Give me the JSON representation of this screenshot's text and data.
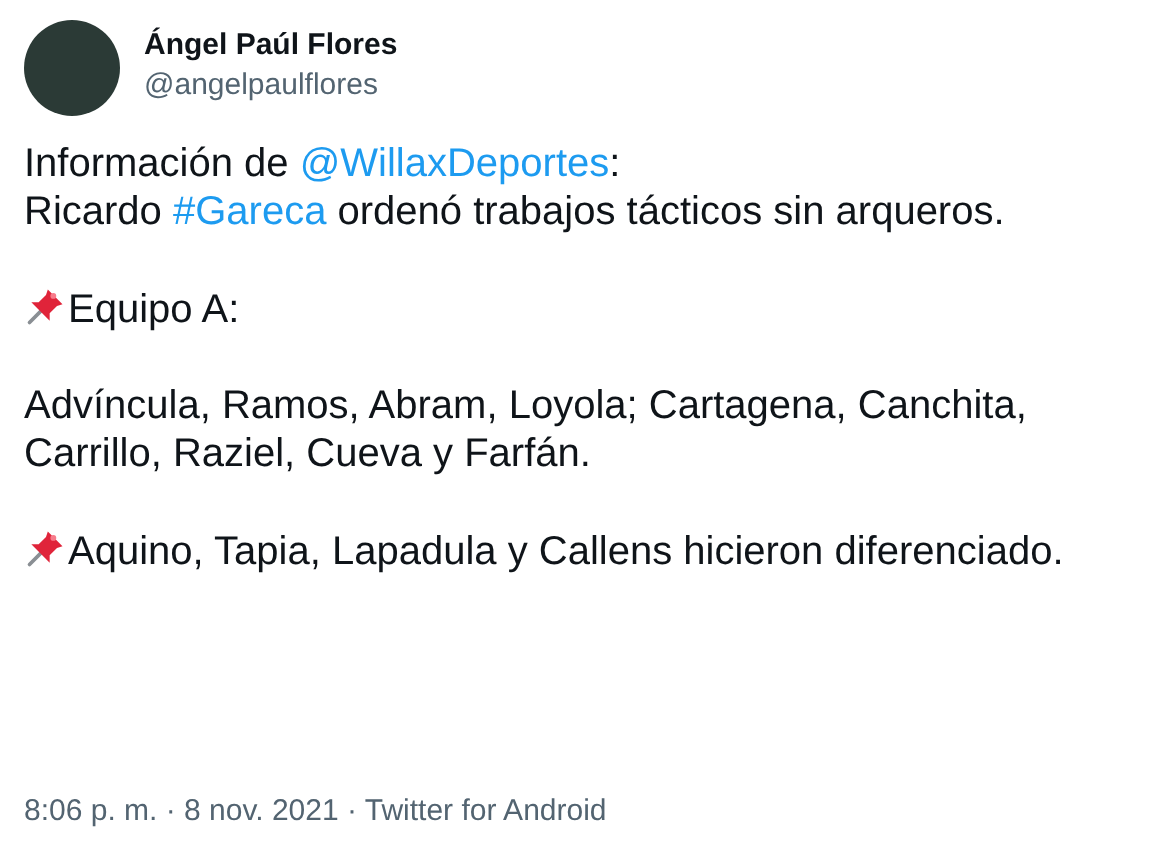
{
  "author": {
    "name": "Ángel Paúl Flores",
    "handle": "@angelpaulflores"
  },
  "paragraphs": [
    {
      "pinned": false,
      "segments": [
        {
          "kind": "text",
          "text": "Información de "
        },
        {
          "kind": "mention",
          "text": "@WillaxDeportes"
        },
        {
          "kind": "text",
          "text": ":\nRicardo "
        },
        {
          "kind": "hashtag",
          "text": "#Gareca"
        },
        {
          "kind": "text",
          "text": " ordenó trabajos tácticos sin arqueros."
        }
      ]
    },
    {
      "pinned": true,
      "segments": [
        {
          "kind": "text",
          "text": "Equipo A:"
        }
      ]
    },
    {
      "pinned": false,
      "segments": [
        {
          "kind": "text",
          "text": "Advíncula, Ramos, Abram, Loyola; Cartagena, Canchita, Carrillo, Raziel, Cueva y Farfán."
        }
      ]
    },
    {
      "pinned": true,
      "segments": [
        {
          "kind": "text",
          "text": "Aquino, Tapia, Lapadula y Callens hicieron diferenciado."
        }
      ]
    }
  ],
  "footer": "8:06 p. m. · 8 nov. 2021 · Twitter for Android"
}
